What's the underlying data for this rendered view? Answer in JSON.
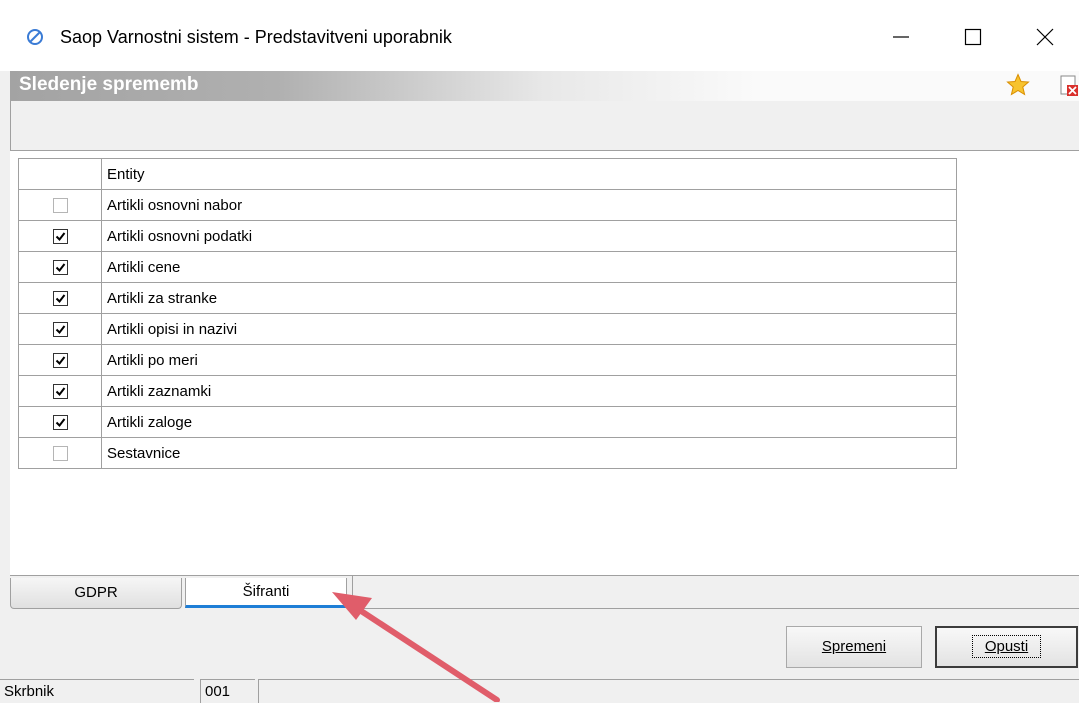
{
  "window": {
    "title": "Saop Varnostni sistem - Predstavitveni uporabnik",
    "app_icon": "saop-logo-icon",
    "minimize_icon": "minimize-icon",
    "maximize_icon": "maximize-icon",
    "close_icon": "close-icon"
  },
  "header": {
    "title": "Sledenje sprememb",
    "favorite_icon": "star-icon",
    "close_document_icon": "close-document-icon"
  },
  "grid": {
    "columns": [
      "",
      "Entity"
    ],
    "rows": [
      {
        "checked": false,
        "entity": "Artikli osnovni nabor"
      },
      {
        "checked": true,
        "entity": "Artikli osnovni podatki"
      },
      {
        "checked": true,
        "entity": "Artikli cene"
      },
      {
        "checked": true,
        "entity": "Artikli za stranke"
      },
      {
        "checked": true,
        "entity": "Artikli opisi in nazivi"
      },
      {
        "checked": true,
        "entity": "Artikli po meri"
      },
      {
        "checked": true,
        "entity": "Artikli zaznamki"
      },
      {
        "checked": true,
        "entity": "Artikli zaloge"
      },
      {
        "checked": false,
        "entity": "Sestavnice"
      }
    ]
  },
  "tabs": [
    {
      "label": "GDPR",
      "active": false
    },
    {
      "label": "Šifranti",
      "active": true
    }
  ],
  "buttons": {
    "save": "Spremeni",
    "cancel": "Opusti"
  },
  "status": {
    "user": "Skrbnik",
    "code": "001"
  },
  "colors": {
    "active_tab_underline": "#1e7ed6",
    "annotation_arrow": "#e05d6a"
  }
}
